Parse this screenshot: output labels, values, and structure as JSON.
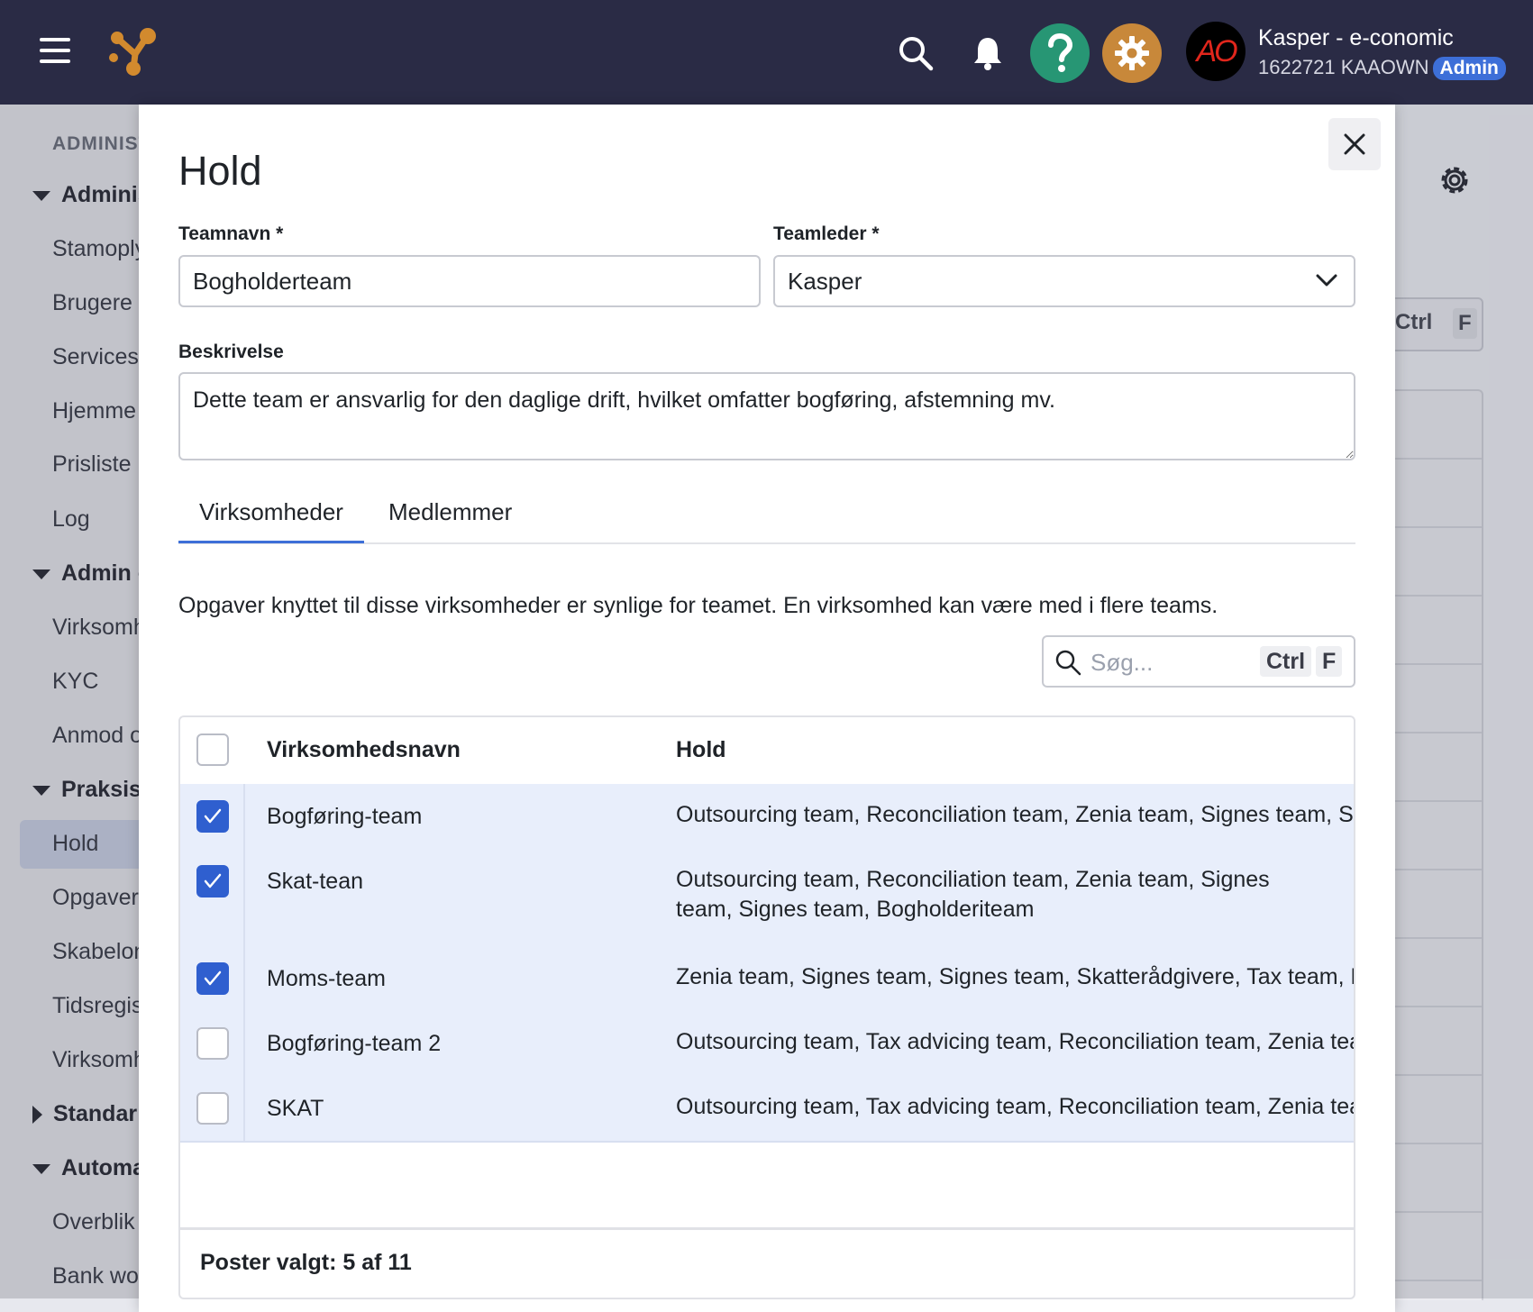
{
  "topbar": {
    "account_name": "Kasper - e-conomic",
    "account_id": "1622721 KAAOWN",
    "role_badge": "Admin",
    "avatar_text": "AO",
    "colors": {
      "bar": "#2a2b45",
      "help": "#279674",
      "settings": "#c8883a",
      "accent": "#3d6fd8"
    }
  },
  "sidebar": {
    "heading": "ADMINIST",
    "sections": [
      {
        "label": "Adminis",
        "items": [
          "Stamoply",
          "Brugere",
          "Services",
          "Hjemme",
          "Prisliste",
          "Log"
        ]
      },
      {
        "label": "Admin o",
        "items": [
          "Virksomh",
          "KYC",
          "Anmod o"
        ]
      },
      {
        "label": "Praksis",
        "items": [
          "Hold",
          "Opgaver",
          "Skabelon",
          "Tidsregis",
          "Virksomh"
        ]
      },
      {
        "label": "Standar",
        "items": []
      },
      {
        "label": "Automa",
        "items": [
          "Overblik",
          "Bank wo"
        ]
      }
    ],
    "active_item": "Hold"
  },
  "background": {
    "kbd_ctrl": "Ctrl",
    "kbd_f": "F"
  },
  "modal": {
    "title": "Hold",
    "team_name_label": "Teamnavn *",
    "team_name_value": "Bogholderteam",
    "team_lead_label": "Teamleder *",
    "team_lead_value": "Kasper",
    "description_label": "Beskrivelse",
    "description_value": "Dette team er ansvarlig for den daglige drift, hvilket omfatter bogføring, afstemning mv.",
    "tabs": [
      {
        "label": "Virksomheder",
        "active": true
      },
      {
        "label": "Medlemmer",
        "active": false
      }
    ],
    "info_text": "Opgaver knyttet til disse virksomheder er synlige for teamet. En virksomhed kan være med i flere teams.",
    "search": {
      "placeholder": "Søg...",
      "kbd_ctrl": "Ctrl",
      "kbd_f": "F"
    },
    "table": {
      "columns": [
        "Virksomhedsnavn",
        "Hold"
      ],
      "rows": [
        {
          "name": "Bogføring-team",
          "hold": "Outsourcing team, Reconciliation team, Zenia team, Signes team, Signes",
          "checked": true
        },
        {
          "name": "Skat-tean",
          "hold": "Outsourcing team, Reconciliation team, Zenia team, Signes team, Signes team, Bogholderiteam",
          "checked": true
        },
        {
          "name": "Moms-team",
          "hold": "Zenia team, Signes team, Signes team, Skatterådgivere, Tax team, Bogholderiteam",
          "checked": true
        },
        {
          "name": "Bogføring-team 2",
          "hold": "Outsourcing team, Tax advicing team, Reconciliation team, Zenia team",
          "checked": false
        },
        {
          "name": "SKAT",
          "hold": "Outsourcing team, Tax advicing team, Reconciliation team, Zenia team",
          "checked": false
        }
      ]
    },
    "footer_text": "Poster valgt: 5 af 11"
  }
}
